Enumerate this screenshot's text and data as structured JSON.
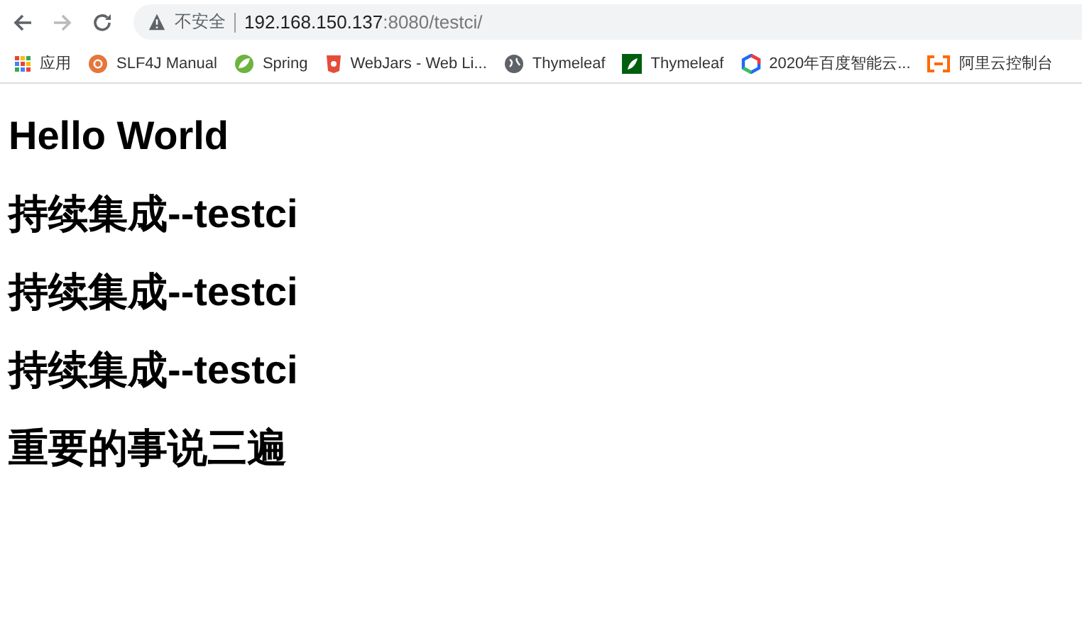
{
  "toolbar": {
    "back": {
      "disabled": false
    },
    "forward": {
      "disabled": true
    }
  },
  "address_bar": {
    "security_label": "不安全",
    "host": "192.168.150.137",
    "path": ":8080/testci/"
  },
  "bookmarks": [
    {
      "label": "应用",
      "kind": "apps"
    },
    {
      "label": "SLF4J Manual",
      "kind": "slf4j"
    },
    {
      "label": "Spring",
      "kind": "spring"
    },
    {
      "label": "WebJars - Web Li...",
      "kind": "webjars"
    },
    {
      "label": "Thymeleaf",
      "kind": "globe"
    },
    {
      "label": "Thymeleaf",
      "kind": "leaf"
    },
    {
      "label": "2020年百度智能云...",
      "kind": "baidu"
    },
    {
      "label": "阿里云控制台",
      "kind": "aliyun"
    }
  ],
  "headings": [
    "Hello World",
    "持续集成--testci",
    "持续集成--testci",
    "持续集成--testci",
    "重要的事说三遍"
  ]
}
